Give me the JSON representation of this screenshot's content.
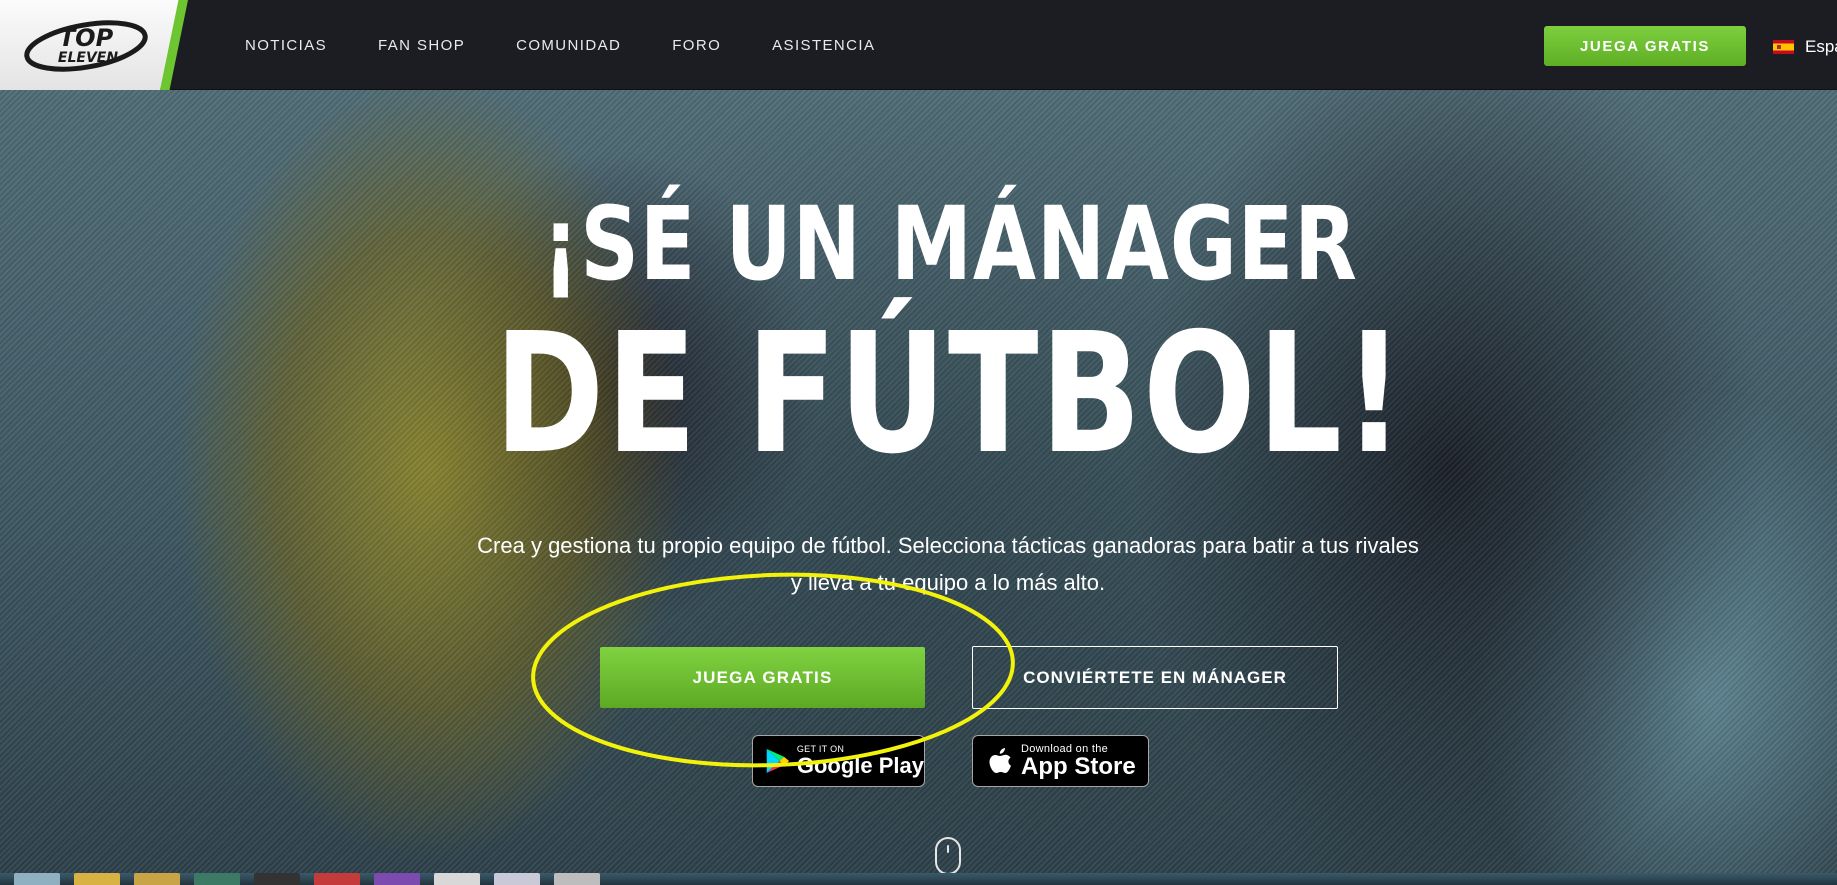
{
  "brand": {
    "logo_word_top": "TOP",
    "logo_word_bottom": "ELEVEN",
    "accent_green": "#6cc531"
  },
  "nav": {
    "items": [
      {
        "label": "NOTICIAS"
      },
      {
        "label": "FAN SHOP"
      },
      {
        "label": "COMUNIDAD"
      },
      {
        "label": "FORO"
      },
      {
        "label": "ASISTENCIA"
      }
    ],
    "cta_label": "JUEGA GRATIS",
    "language_label": "Espa"
  },
  "hero": {
    "headline_line1": "¡SÉ UN MÁNAGER",
    "headline_line2": "DE FÚTBOL!",
    "subtitle_line1": "Crea y gestiona tu propio equipo de fútbol. Selecciona tácticas ganadoras para batir a tus rivales",
    "subtitle_line2": "y lleva a tu equipo a lo más alto.",
    "primary_button": "JUEGA GRATIS",
    "secondary_button": "CONVIÉRTETE EN MÁNAGER",
    "google_play": {
      "small": "GET IT ON",
      "large": "Google Play"
    },
    "app_store": {
      "small": "Download on the",
      "large": "App Store"
    }
  },
  "annotation": {
    "color": "#f2f20a"
  }
}
